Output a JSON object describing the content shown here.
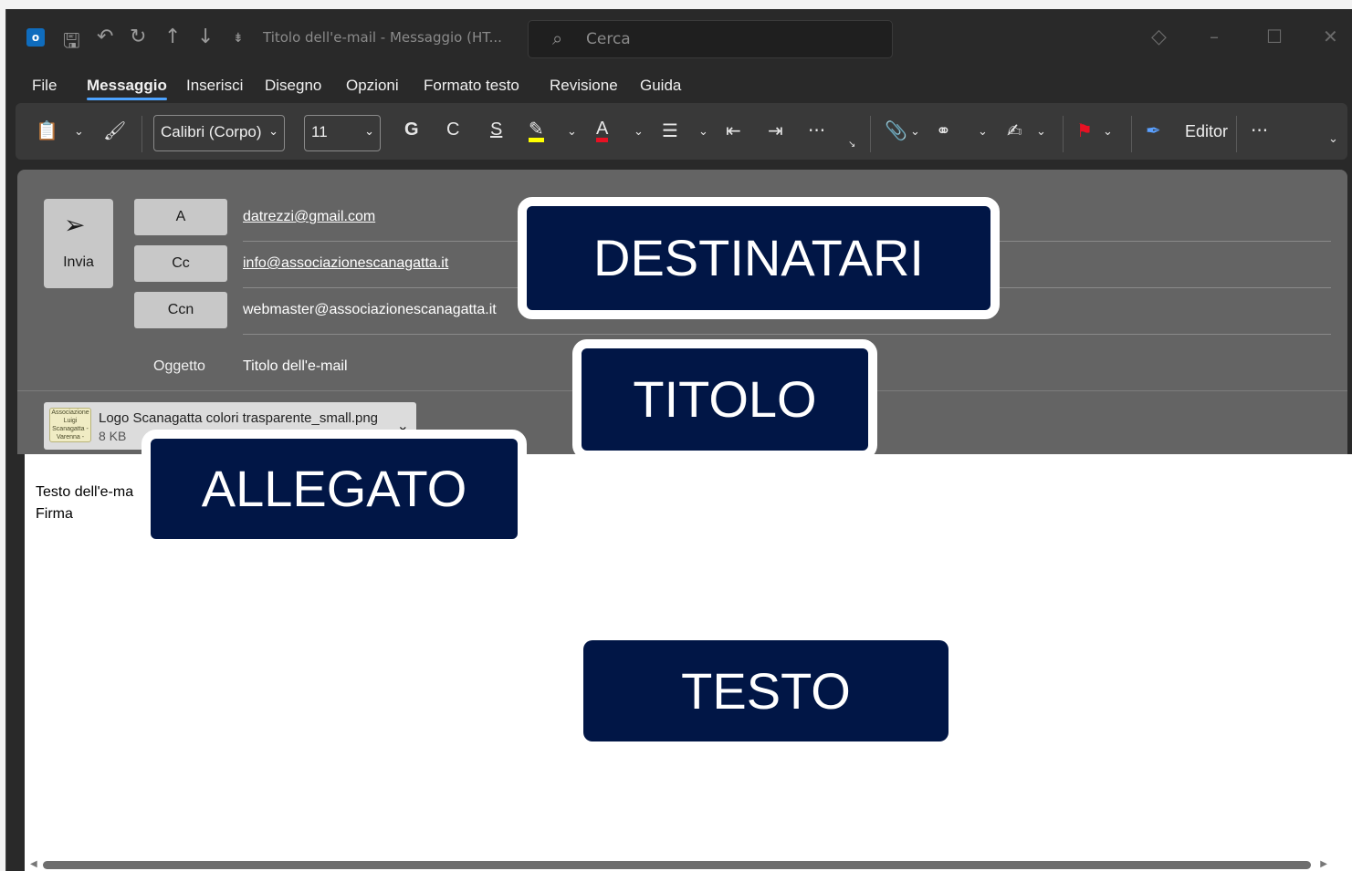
{
  "titlebar": {
    "title": "Titolo dell'e-mail  -  Messaggio (HT...",
    "search_placeholder": "Cerca",
    "app_icon_letter": "o"
  },
  "menu": {
    "items": [
      "File",
      "Messaggio",
      "Inserisci",
      "Disegno",
      "Opzioni",
      "Formato testo",
      "Revisione",
      "Guida"
    ],
    "active": "Messaggio"
  },
  "ribbon": {
    "font_name": "Calibri (Corpo)",
    "font_size": "11",
    "bold_label": "G",
    "italic_label": "C",
    "underline_label": "S",
    "font_color_label": "A",
    "more_label": "···",
    "editor_label": "Editor",
    "highlight_color": "#ffff00",
    "font_color": "#e81123"
  },
  "compose": {
    "send_label": "Invia",
    "to_label": "A",
    "cc_label": "Cc",
    "bcc_label": "Ccn",
    "subject_label": "Oggetto",
    "to_value": "datrezzi@gmail.com",
    "cc_value": "info@associazionescanagatta.it",
    "bcc_value": "webmaster@associazionescanagatta.it",
    "subject_value": "Titolo dell'e-mail"
  },
  "attachment": {
    "name": "Logo Scanagatta colori trasparente_small.png",
    "size": "8 KB",
    "thumb_text": "Associazione Luigi Scanagatta - Varenna -"
  },
  "body": {
    "line1": "Testo dell'e-ma",
    "line2": "Firma"
  },
  "overlays": {
    "destinatari": "DESTINATARI",
    "titolo": "TITOLO",
    "allegato": "ALLEGATO",
    "testo": "TESTO"
  }
}
